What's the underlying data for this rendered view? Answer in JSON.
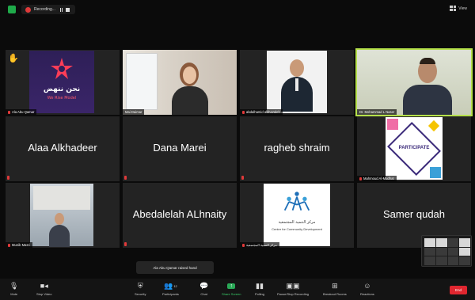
{
  "topbar": {
    "recording_label": "Recording...",
    "view_label": "View"
  },
  "participants": [
    {
      "name": "Ala Abu Qamar",
      "kind": "video",
      "hand_raised": true
    },
    {
      "name": "Mai Daimar",
      "kind": "video"
    },
    {
      "name": "abdalhamid alkhazaleh",
      "kind": "video"
    },
    {
      "name": "Dr. Mohammad L Naser",
      "kind": "video",
      "active_speaker": true
    },
    {
      "name": "Alaa Alkhadeer",
      "kind": "name"
    },
    {
      "name": "Dana Marei",
      "kind": "name"
    },
    {
      "name": "ragheb shraim",
      "kind": "name"
    },
    {
      "name": "Mahmoud Al-Mudhat",
      "kind": "video"
    },
    {
      "name": "Munib Masri",
      "kind": "video"
    },
    {
      "name": "Abedalelah ALhnaity",
      "kind": "name"
    },
    {
      "name": "مركز التنمية المجتمعية",
      "kind": "video"
    },
    {
      "name": "Samer qudah",
      "kind": "name"
    }
  ],
  "posters": {
    "arabic_title": "نحن ننهض",
    "subtitle": "We Rise Model",
    "participate": "PARTICIPATE",
    "center_ar": "مركز التنمية المجتمعية",
    "center_en": "Center for Community Development"
  },
  "toast": "Ala Abu Qamar raised hand",
  "toolbar": {
    "items": [
      {
        "label": "Mute",
        "icon": "microphone-icon"
      },
      {
        "label": "Stop Video",
        "icon": "video-camera-icon"
      },
      {
        "label": "Security",
        "icon": "shield-icon"
      },
      {
        "label": "Participants",
        "icon": "participants-icon",
        "count": "12"
      },
      {
        "label": "Chat",
        "icon": "chat-icon"
      },
      {
        "label": "Share Screen",
        "icon": "share-screen-icon"
      },
      {
        "label": "Polling",
        "icon": "polling-icon"
      },
      {
        "label": "Pause/Stop Recording",
        "icon": "recording-icon"
      },
      {
        "label": "Breakout Rooms",
        "icon": "breakout-rooms-icon"
      },
      {
        "label": "Reactions",
        "icon": "reactions-icon"
      }
    ],
    "end_label": "End"
  },
  "colors": {
    "active_border": "#b5e04a",
    "end_red": "#e0262f",
    "share_green": "#2aa857",
    "tile_bg": "#232323"
  }
}
